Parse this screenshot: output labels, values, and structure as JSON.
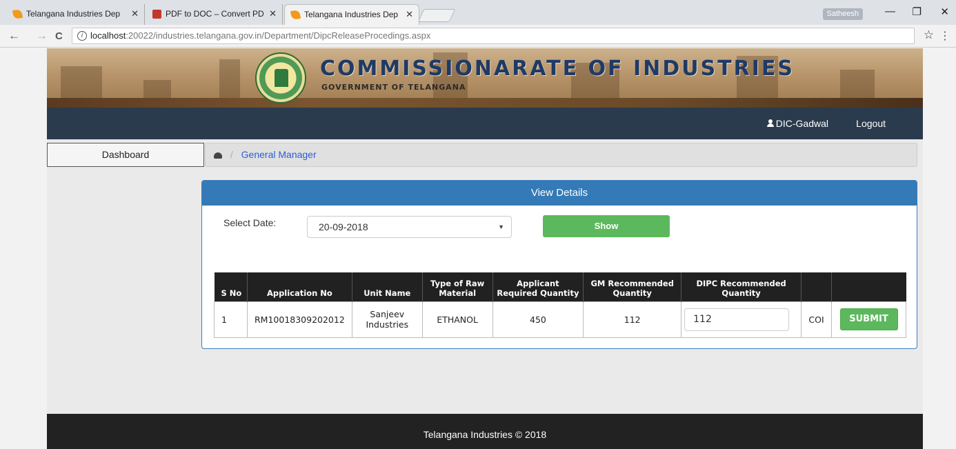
{
  "browser": {
    "tabs": [
      {
        "title": "Telangana Industries Dep",
        "favicon": "lotus-icon"
      },
      {
        "title": "PDF to DOC – Convert PD",
        "favicon": "pdf-icon"
      },
      {
        "title": "Telangana Industries Dep",
        "favicon": "lotus-icon",
        "active": true
      }
    ],
    "close_glyph": "✕",
    "profile_name": "Satheesh",
    "window_minimize": "—",
    "window_restore": "❐",
    "window_close": "✕",
    "back_glyph": "←",
    "forward_glyph": "→",
    "reload_glyph": "C",
    "info_glyph": "i",
    "url_host": "localhost",
    "url_path": ":20022/industries.telangana.gov.in/Department/DipcReleaseProcedings.aspx",
    "star_glyph": "☆",
    "menu_glyph": "⋮"
  },
  "header": {
    "title": "COMMISSIONARATE OF INDUSTRIES",
    "subtitle": "GOVERNMENT OF TELANGANA",
    "emblem_text": "GOVERNMENT OF TELANGANA"
  },
  "nav": {
    "user": "DIC-Gadwal",
    "logout": "Logout"
  },
  "sidebar": {
    "dashboard": "Dashboard"
  },
  "breadcrumb": {
    "separator": "/",
    "current": "General Manager"
  },
  "panel": {
    "title": "View Details",
    "date_label": "Select Date:",
    "date_value": "20-09-2018",
    "caret": "▼",
    "show_button": "Show"
  },
  "table": {
    "headers": {
      "sno": "S No",
      "app_no": "Application No",
      "unit_name": "Unit Name",
      "raw_material": "Type of Raw Material",
      "applicant_qty": "Applicant Required Quantity",
      "gm_qty": "GM Recommended Quantity",
      "dipc_qty": "DIPC Recommended Quantity"
    },
    "rows": [
      {
        "sno": "1",
        "app_no": "RM10018309202012",
        "unit_name": "Sanjeev Industries",
        "raw_material": "ETHANOL",
        "applicant_qty": "450",
        "gm_qty": "112",
        "dipc_qty": "112",
        "coi": "COI",
        "submit": "SUBMIT"
      }
    ]
  },
  "footer": {
    "text": "Telangana Industries © 2018"
  },
  "colors": {
    "navbar": "#2b3b4e",
    "panel_header": "#337ab7",
    "button_green": "#5cb85c",
    "table_header": "#212121",
    "footer": "#222222"
  }
}
